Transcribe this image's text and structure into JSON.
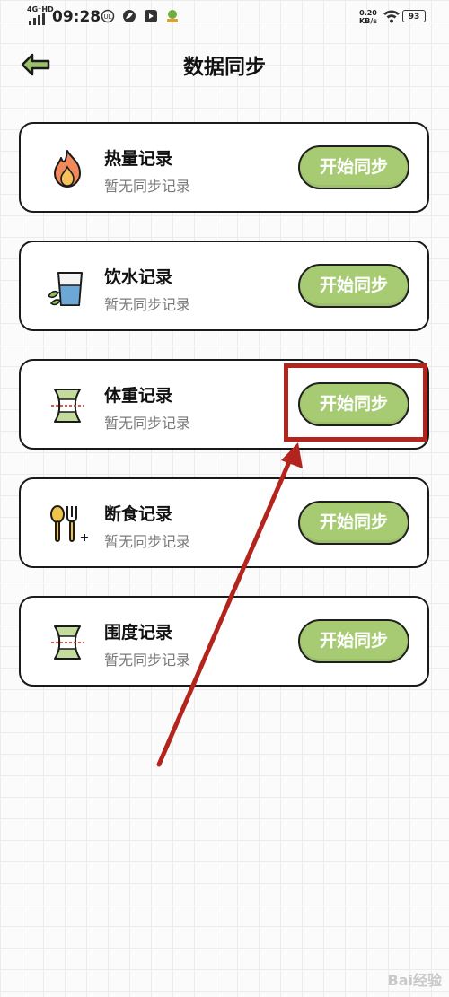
{
  "status_bar": {
    "network": "4G⁺HD",
    "time": "09:28",
    "icons": [
      "ul-icon",
      "leaf-app-icon",
      "video-app-icon",
      "game-app-icon"
    ],
    "net_speed_value": "0.20",
    "net_speed_unit": "KB/s",
    "battery": "93"
  },
  "header": {
    "title": "数据同步",
    "back_icon": "back-arrow-icon"
  },
  "cards": [
    {
      "title": "热量记录",
      "subtitle": "暂无同步记录",
      "button": "开始同步",
      "icon": "flame-icon"
    },
    {
      "title": "饮水记录",
      "subtitle": "暂无同步记录",
      "button": "开始同步",
      "icon": "water-glass-icon"
    },
    {
      "title": "体重记录",
      "subtitle": "暂无同步记录",
      "button": "开始同步",
      "icon": "waist-icon"
    },
    {
      "title": "断食记录",
      "subtitle": "暂无同步记录",
      "button": "开始同步",
      "icon": "spoon-fork-icon"
    },
    {
      "title": "围度记录",
      "subtitle": "暂无同步记录",
      "button": "开始同步",
      "icon": "waist-measure-icon"
    }
  ],
  "annotation": {
    "highlighted_card": "体重记录",
    "color": "#b3241c"
  },
  "watermark": "Bai经验",
  "colors": {
    "button_fill": "#a6cb72",
    "button_text": "#ffffff",
    "back_arrow": "#9bc26a",
    "annotation": "#b3241c"
  }
}
